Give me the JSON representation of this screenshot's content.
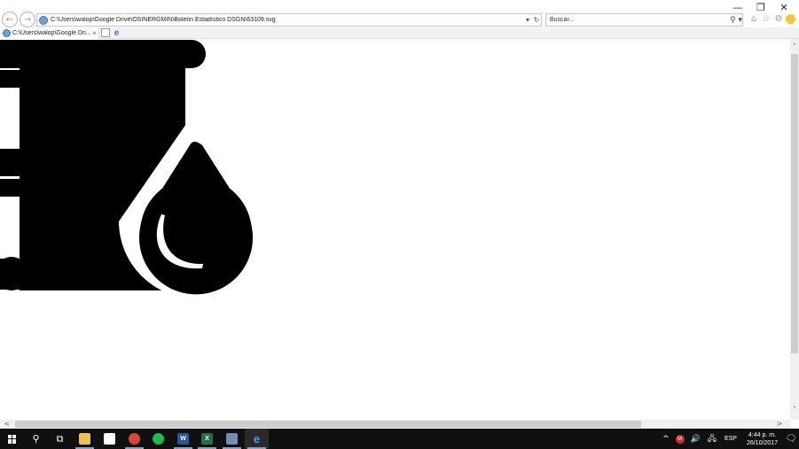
{
  "window": {
    "minimize_glyph": "—",
    "restore_glyph": "❐",
    "close_glyph": "✕"
  },
  "browser": {
    "address": "C:\\Users\\walop\\Google Drive\\OSINERGMIN\\Boletín Estadístico DSGN\\63109.svg",
    "address_dropdown_glyph": "▾",
    "refresh_glyph": "↻",
    "search_placeholder": "Buscar...",
    "search_glyph": "⚲ ▾",
    "back_glyph": "←",
    "forward_glyph": "→",
    "home_glyph": "⌂",
    "favorites_glyph": "☆",
    "settings_glyph": "⚙"
  },
  "tabs": [
    {
      "label": "C:\\Users\\walop\\Google Dri...",
      "close_glyph": "×"
    }
  ],
  "ie_tab_glyph": "e",
  "content": {
    "image_description_icon": "oil-barrel-drop-icon",
    "fill_color": "#000000"
  },
  "scrollbar": {
    "up_glyph": "˄",
    "down_glyph": "˅",
    "left_glyph": "<",
    "right_glyph": ">"
  },
  "taskbar": {
    "search_glyph": "⚲",
    "taskview_glyph": "⧉",
    "apps": [
      {
        "name": "file-explorer",
        "color": "#f0c24a",
        "label": ""
      },
      {
        "name": "mail",
        "color": "#ffffff",
        "label": ""
      },
      {
        "name": "chrome",
        "color": "#db4437",
        "label": ""
      },
      {
        "name": "spotify",
        "color": "#1db954",
        "label": ""
      },
      {
        "name": "word",
        "color": "#2b579a",
        "label": "W"
      },
      {
        "name": "excel",
        "color": "#217346",
        "label": "X"
      },
      {
        "name": "app-window",
        "color": "#6f8fb8",
        "label": ""
      },
      {
        "name": "internet-explorer",
        "color": "#1e7fd6",
        "label": "e"
      }
    ],
    "tray": {
      "chevron": "^",
      "badge": "M",
      "volume_glyph": "🔊",
      "network_glyph": "🖧",
      "language": "ESP",
      "time": "4:44 p. m.",
      "date": "26/10/2017",
      "notification_glyph": "🗨"
    }
  }
}
